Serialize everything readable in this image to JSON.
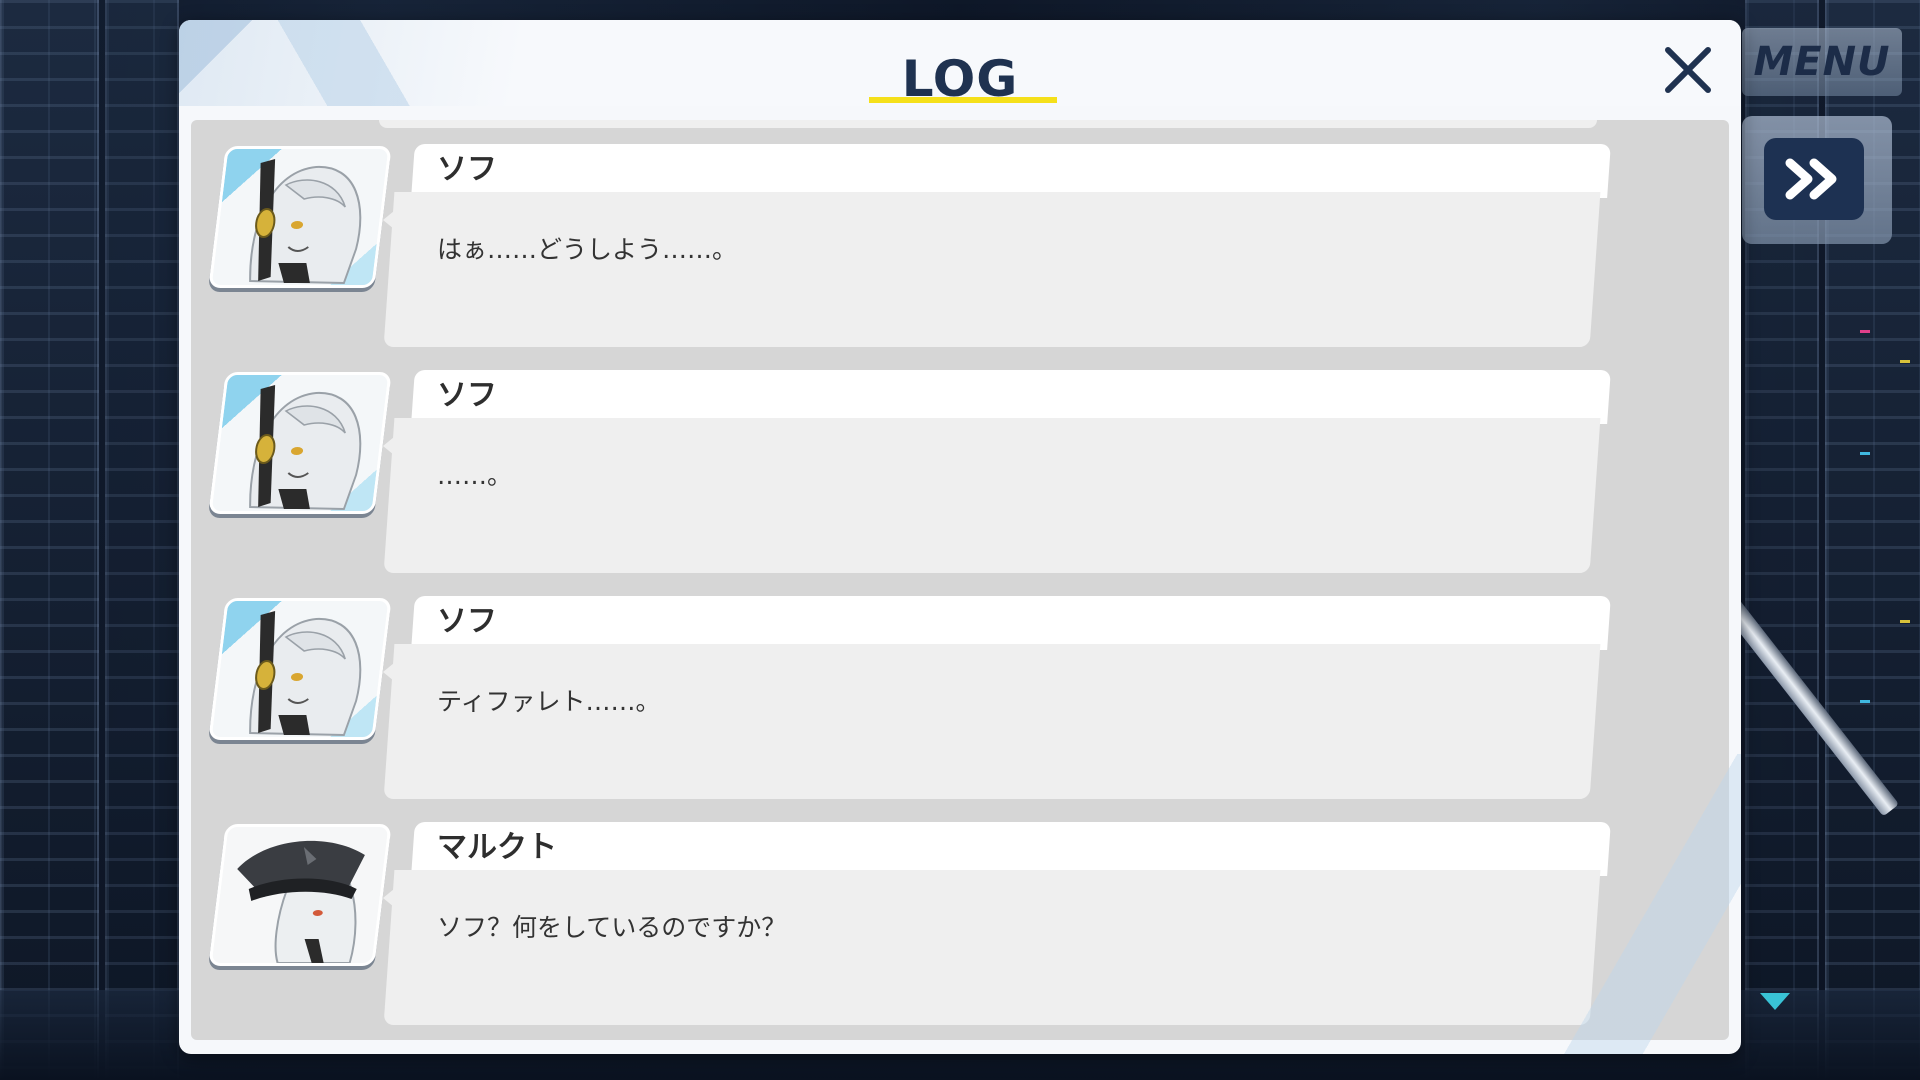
{
  "window": {
    "title": "LOG",
    "close_icon": "close-icon"
  },
  "hud": {
    "menu_label": "MENU",
    "skip_icon": "fast-forward-icon",
    "scroll_icon": "down-arrow-icon"
  },
  "colors": {
    "title_text": "#1f3250",
    "title_underline": "#f5e01a",
    "skip_button": "#1d3152",
    "scroll_indicator": "#39c3d6"
  },
  "log": {
    "entries": [
      {
        "speaker": "ソフ",
        "portrait": "sof-portrait",
        "text": "はぁ……どうしよう……。"
      },
      {
        "speaker": "ソフ",
        "portrait": "sof-portrait",
        "text": "……。"
      },
      {
        "speaker": "ソフ",
        "portrait": "sof-portrait",
        "text": "ティファレト……。"
      },
      {
        "speaker": "マルクト",
        "portrait": "malkuth-portrait",
        "text": "ソフ？何をしているのですか？"
      }
    ]
  }
}
